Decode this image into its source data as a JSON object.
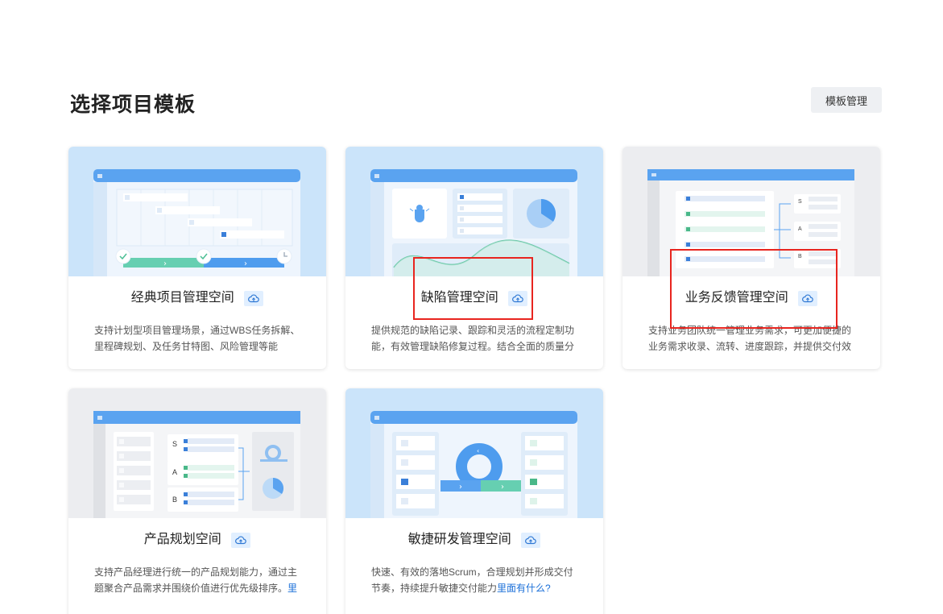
{
  "header": {
    "title": "选择项目模板",
    "manage_button": "模板管理"
  },
  "templates": [
    {
      "name": "经典项目管理空间",
      "description": "支持计划型项目管理场景，通过WBS任务拆解、里程碑规划、及任务甘特图、风险管理等能",
      "thumb_bg": "#cbe4fa"
    },
    {
      "name": "缺陷管理空间",
      "description": "提供规范的缺陷记录、跟踪和灵活的流程定制功能，有效管理缺陷修复过程。结合全面的质量分",
      "thumb_bg": "#cbe4fa"
    },
    {
      "name": "业务反馈管理空间",
      "description": "支持业务团队统一管理业务需求，可更加便捷的业务需求收录、流转、进度跟踪，并提供交付效",
      "thumb_bg": "#ecedf0",
      "priority_labels": [
        "S",
        "A",
        "B"
      ]
    },
    {
      "name": "产品规划空间",
      "description": "支持产品经理进行统一的产品规划能力，通过主题聚合产品需求并围绕价值进行优先级排序。",
      "link_text": "里",
      "thumb_bg": "#ecedf0",
      "priority_labels": [
        "S",
        "A",
        "B"
      ]
    },
    {
      "name": "敏捷研发管理空间",
      "description": "快速、有效的落地Scrum，合理规划并形成交付节奏，持续提升敏捷交付能力",
      "link_text": "里面有什么?",
      "thumb_bg": "#cbe4fa"
    }
  ],
  "colors": {
    "accent": "#1a6fd8",
    "highlight_box": "#e8251f",
    "badge_bg": "#e1efff"
  },
  "icons": {
    "template_badge": "cloud-upload-icon"
  }
}
